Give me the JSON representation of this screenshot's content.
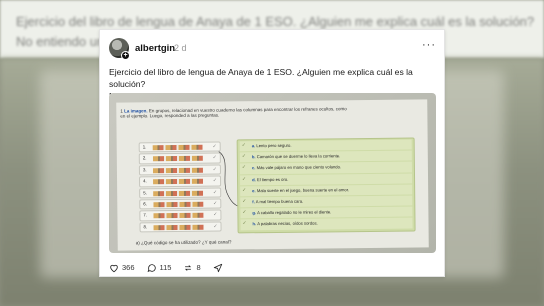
{
  "background": {
    "line1": "Ejercicio del libro de lengua de Anaya de 1 ESO. ¿Alguien me explica cuál es la solución?",
    "line2": "No entiendo una mierda"
  },
  "post": {
    "username": "albertgin",
    "timestamp": "2 d",
    "more_label": "···",
    "text_line1": "Ejercicio del libro de lengua de Anaya de 1 ESO. ¿Alguien me explica cuál es la solución?",
    "text_line2": "No entiendo una mierda"
  },
  "photo": {
    "exercise_number": "1",
    "exercise_title": "La imagen.",
    "exercise_body": "En grupos, relacionad en vuestro cuaderno las columnas para encontrar los refranes ocultos, como en el ejemplo. Luego, responded a las preguntas.",
    "left_items": [
      "1.",
      "2.",
      "3.",
      "4.",
      "5.",
      "6.",
      "7.",
      "8."
    ],
    "answers": [
      {
        "letter": "a.",
        "text": "Lento pero seguro."
      },
      {
        "letter": "b.",
        "text": "Camarón que se duerme lo lleva la corriente."
      },
      {
        "letter": "c.",
        "text": "Más vale pájaro en mano que ciento volando."
      },
      {
        "letter": "d.",
        "text": "El tiempo es oro."
      },
      {
        "letter": "e.",
        "text": "Mala suerte en el juego, buena suerte en el amor."
      },
      {
        "letter": "f.",
        "text": "A mal tiempo buena cara."
      },
      {
        "letter": "g.",
        "text": "A caballo regalado no le mires el diente."
      },
      {
        "letter": "h.",
        "text": "A palabras necias, oídos sordos."
      }
    ],
    "question": "a) ¿Qué código se ha utilizado? ¿Y qué canal?"
  },
  "actions": {
    "likes": "366",
    "comments": "115",
    "reposts": "8"
  },
  "colors": {
    "card_bg": "#ffffff",
    "answer_panel": "#cfdca8",
    "accent_blue": "#1e4fa3"
  }
}
